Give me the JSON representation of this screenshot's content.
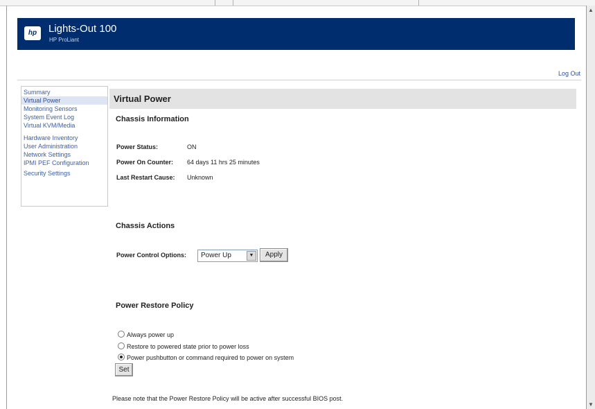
{
  "brand": {
    "logo_text": "hp",
    "title": "Lights-Out 100",
    "subtitle": "HP ProLiant"
  },
  "header_links": {
    "logout": "Log Out"
  },
  "sidebar": {
    "items": [
      {
        "label": "Summary"
      },
      {
        "label": "Virtual Power"
      },
      {
        "label": "Monitoring Sensors"
      },
      {
        "label": "System Event Log"
      },
      {
        "label": "Virtual KVM/Media"
      },
      {
        "label": "Hardware Inventory"
      },
      {
        "label": "User Administration"
      },
      {
        "label": "Network Settings"
      },
      {
        "label": "IPMI PEF Configuration"
      },
      {
        "label": "Security Settings"
      }
    ],
    "active": "Virtual Power"
  },
  "main": {
    "title": "Virtual Power",
    "chassis_info": {
      "heading": "Chassis Information",
      "power_status_label": "Power Status:",
      "power_status_value": "ON",
      "power_on_counter_label": "Power On Counter:",
      "power_on_counter_value": "64 days 11 hrs 25 minutes",
      "last_restart_label": "Last Restart Cause:",
      "last_restart_value": "Unknown"
    },
    "chassis_actions": {
      "heading": "Chassis Actions",
      "power_control_label": "Power Control Options:",
      "selected_option": "Power Up",
      "apply_label": "Apply"
    },
    "restore_policy": {
      "heading": "Power Restore Policy",
      "options": [
        "Always power up",
        "Restore to powered state prior to power loss",
        "Power pushbutton or command required to power on system"
      ],
      "selected_index": 2,
      "set_label": "Set",
      "note": "Please note that the Power Restore Policy will be active after successful BIOS post."
    }
  }
}
